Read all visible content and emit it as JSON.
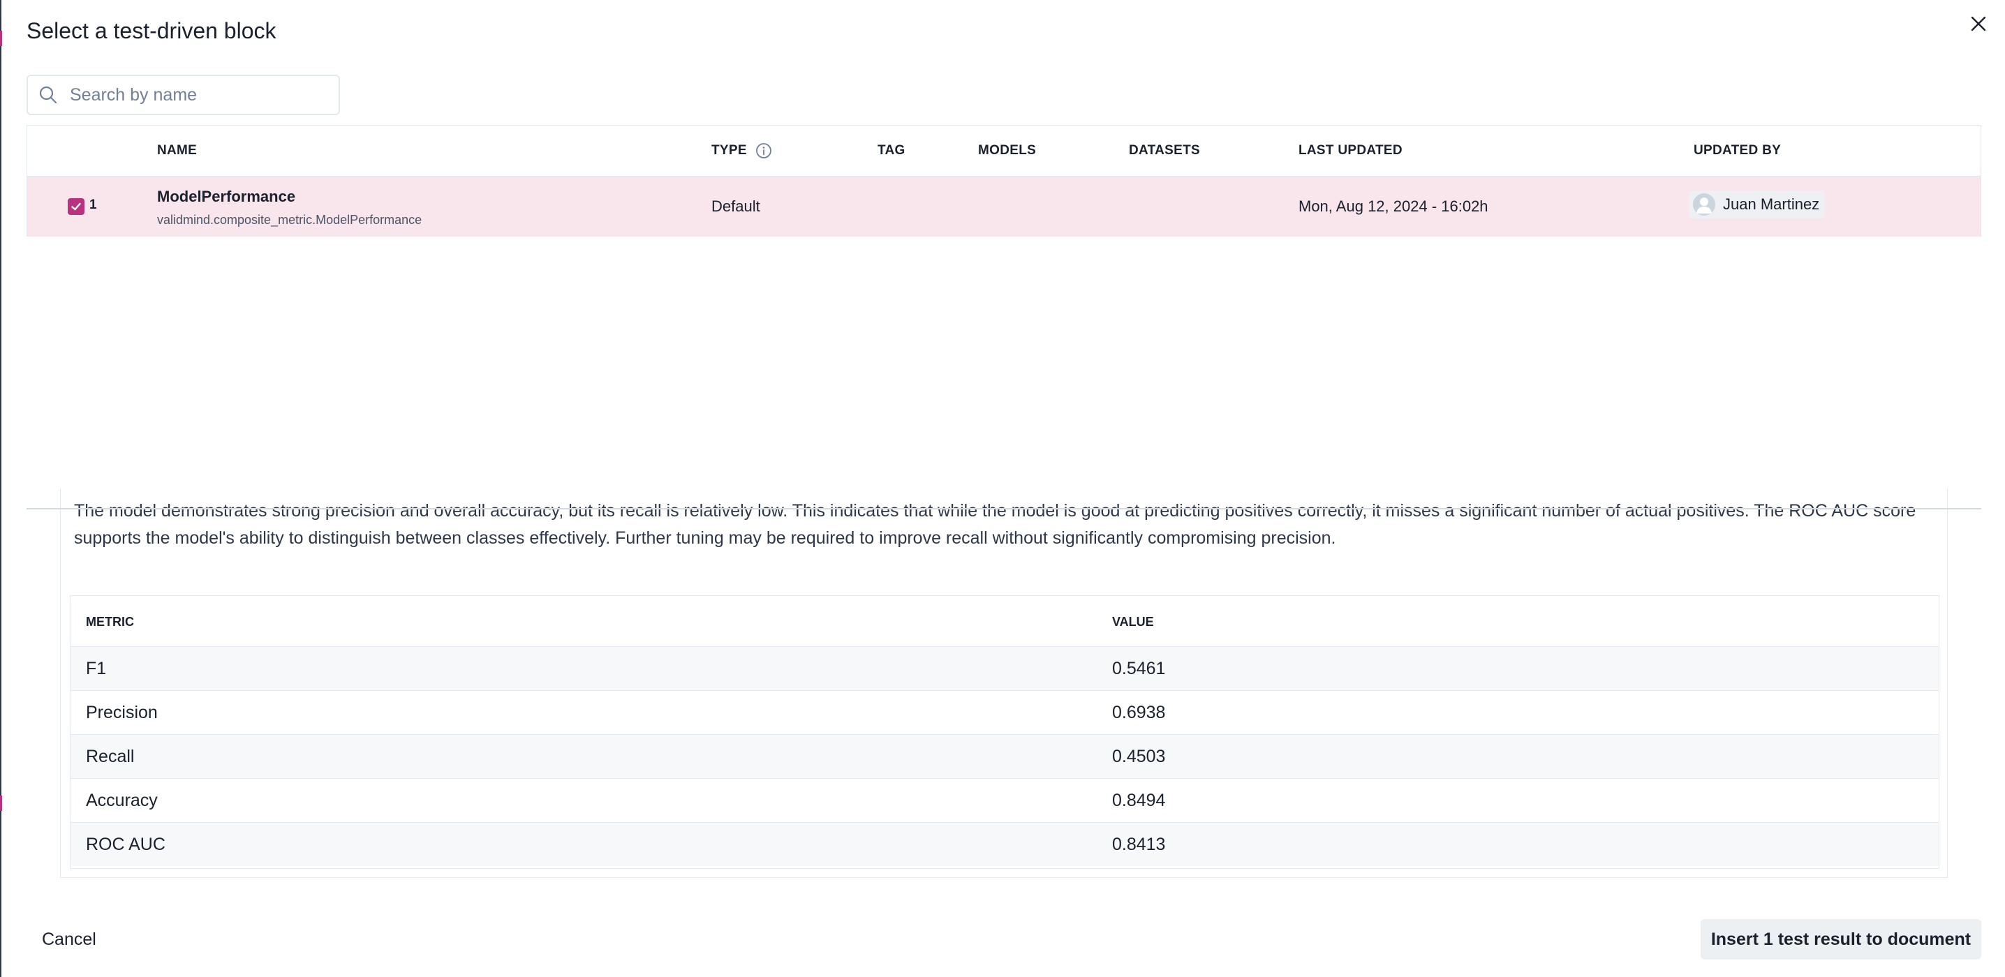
{
  "modal": {
    "title": "Select a test-driven block",
    "close_icon": "close-icon"
  },
  "search": {
    "placeholder": "Search by name",
    "value": "",
    "icon": "search-icon"
  },
  "blocks_table": {
    "headers": {
      "name": "NAME",
      "type": "TYPE",
      "tag": "TAG",
      "models": "MODELS",
      "datasets": "DATASETS",
      "last_updated": "LAST UPDATED",
      "updated_by": "UPDATED BY"
    },
    "type_info_icon": "info-icon",
    "rows": [
      {
        "checked": true,
        "index": "1",
        "name": "ModelPerformance",
        "path": "validmind.composite_metric.ModelPerformance",
        "type": "Default",
        "tag": "",
        "models": "",
        "datasets": "",
        "last_updated": "Mon, Aug 12, 2024 - 16:02h",
        "updated_by": "Juan Martinez"
      }
    ]
  },
  "preview": {
    "description": "The model demonstrates strong precision and overall accuracy, but its recall is relatively low. This indicates that while the model is good at predicting positives correctly, it misses a significant number of actual positives. The ROC AUC score supports the model's ability to distinguish between classes effectively. Further tuning may be required to improve recall without significantly compromising precision.",
    "metrics_table": {
      "headers": {
        "metric": "METRIC",
        "value": "VALUE"
      },
      "rows": [
        {
          "metric": "F1",
          "value": "0.5461"
        },
        {
          "metric": "Precision",
          "value": "0.6938"
        },
        {
          "metric": "Recall",
          "value": "0.4503"
        },
        {
          "metric": "Accuracy",
          "value": "0.8494"
        },
        {
          "metric": "ROC AUC",
          "value": "0.8413"
        }
      ]
    }
  },
  "footer": {
    "cancel_label": "Cancel",
    "insert_label": "Insert 1 test result to document"
  },
  "colors": {
    "accent": "#b83280",
    "selected_row_bg": "#f9e5ec",
    "button_bg": "#edf0f3"
  }
}
